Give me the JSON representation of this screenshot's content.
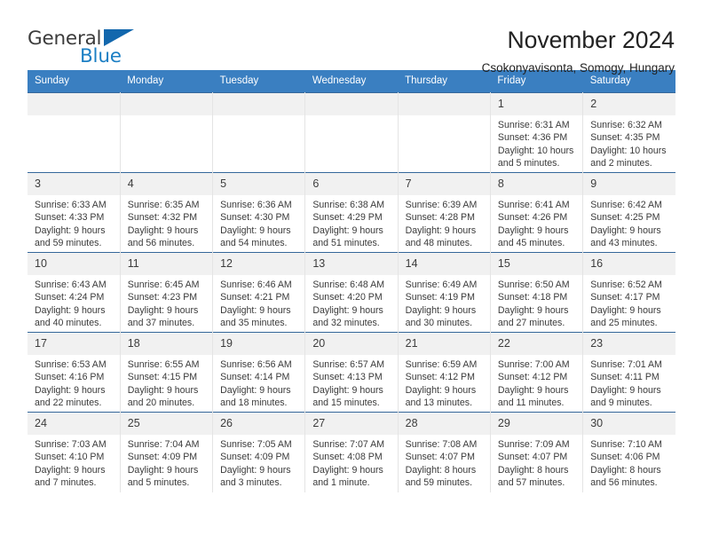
{
  "brand": {
    "name_top": "General",
    "name_bottom": "Blue",
    "triangle_color": "#1267ad",
    "blue_color": "#1c7fc4",
    "gray_color": "#3c3c3c"
  },
  "header": {
    "title": "November 2024",
    "subtitle": "Csokonyavisonta, Somogy, Hungary"
  },
  "theme": {
    "header_row_bg": "#3a7fc1",
    "header_row_text": "#ffffff",
    "daynum_bg": "#f1f1f1",
    "row_border": "#35679a",
    "cell_divider": "#e4e4e4"
  },
  "weekdays": [
    "Sunday",
    "Monday",
    "Tuesday",
    "Wednesday",
    "Thursday",
    "Friday",
    "Saturday"
  ],
  "labels": {
    "sunrise_prefix": "Sunrise:",
    "sunset_prefix": "Sunset:",
    "daylight_prefix": "Daylight:"
  },
  "weeks": [
    [
      {
        "day": "",
        "blank": true
      },
      {
        "day": "",
        "blank": true
      },
      {
        "day": "",
        "blank": true
      },
      {
        "day": "",
        "blank": true
      },
      {
        "day": "",
        "blank": true
      },
      {
        "day": "1",
        "sunrise": "Sunrise: 6:31 AM",
        "sunset": "Sunset: 4:36 PM",
        "daylight_1": "Daylight: 10 hours",
        "daylight_2": "and 5 minutes."
      },
      {
        "day": "2",
        "sunrise": "Sunrise: 6:32 AM",
        "sunset": "Sunset: 4:35 PM",
        "daylight_1": "Daylight: 10 hours",
        "daylight_2": "and 2 minutes."
      }
    ],
    [
      {
        "day": "3",
        "sunrise": "Sunrise: 6:33 AM",
        "sunset": "Sunset: 4:33 PM",
        "daylight_1": "Daylight: 9 hours",
        "daylight_2": "and 59 minutes."
      },
      {
        "day": "4",
        "sunrise": "Sunrise: 6:35 AM",
        "sunset": "Sunset: 4:32 PM",
        "daylight_1": "Daylight: 9 hours",
        "daylight_2": "and 56 minutes."
      },
      {
        "day": "5",
        "sunrise": "Sunrise: 6:36 AM",
        "sunset": "Sunset: 4:30 PM",
        "daylight_1": "Daylight: 9 hours",
        "daylight_2": "and 54 minutes."
      },
      {
        "day": "6",
        "sunrise": "Sunrise: 6:38 AM",
        "sunset": "Sunset: 4:29 PM",
        "daylight_1": "Daylight: 9 hours",
        "daylight_2": "and 51 minutes."
      },
      {
        "day": "7",
        "sunrise": "Sunrise: 6:39 AM",
        "sunset": "Sunset: 4:28 PM",
        "daylight_1": "Daylight: 9 hours",
        "daylight_2": "and 48 minutes."
      },
      {
        "day": "8",
        "sunrise": "Sunrise: 6:41 AM",
        "sunset": "Sunset: 4:26 PM",
        "daylight_1": "Daylight: 9 hours",
        "daylight_2": "and 45 minutes."
      },
      {
        "day": "9",
        "sunrise": "Sunrise: 6:42 AM",
        "sunset": "Sunset: 4:25 PM",
        "daylight_1": "Daylight: 9 hours",
        "daylight_2": "and 43 minutes."
      }
    ],
    [
      {
        "day": "10",
        "sunrise": "Sunrise: 6:43 AM",
        "sunset": "Sunset: 4:24 PM",
        "daylight_1": "Daylight: 9 hours",
        "daylight_2": "and 40 minutes."
      },
      {
        "day": "11",
        "sunrise": "Sunrise: 6:45 AM",
        "sunset": "Sunset: 4:23 PM",
        "daylight_1": "Daylight: 9 hours",
        "daylight_2": "and 37 minutes."
      },
      {
        "day": "12",
        "sunrise": "Sunrise: 6:46 AM",
        "sunset": "Sunset: 4:21 PM",
        "daylight_1": "Daylight: 9 hours",
        "daylight_2": "and 35 minutes."
      },
      {
        "day": "13",
        "sunrise": "Sunrise: 6:48 AM",
        "sunset": "Sunset: 4:20 PM",
        "daylight_1": "Daylight: 9 hours",
        "daylight_2": "and 32 minutes."
      },
      {
        "day": "14",
        "sunrise": "Sunrise: 6:49 AM",
        "sunset": "Sunset: 4:19 PM",
        "daylight_1": "Daylight: 9 hours",
        "daylight_2": "and 30 minutes."
      },
      {
        "day": "15",
        "sunrise": "Sunrise: 6:50 AM",
        "sunset": "Sunset: 4:18 PM",
        "daylight_1": "Daylight: 9 hours",
        "daylight_2": "and 27 minutes."
      },
      {
        "day": "16",
        "sunrise": "Sunrise: 6:52 AM",
        "sunset": "Sunset: 4:17 PM",
        "daylight_1": "Daylight: 9 hours",
        "daylight_2": "and 25 minutes."
      }
    ],
    [
      {
        "day": "17",
        "sunrise": "Sunrise: 6:53 AM",
        "sunset": "Sunset: 4:16 PM",
        "daylight_1": "Daylight: 9 hours",
        "daylight_2": "and 22 minutes."
      },
      {
        "day": "18",
        "sunrise": "Sunrise: 6:55 AM",
        "sunset": "Sunset: 4:15 PM",
        "daylight_1": "Daylight: 9 hours",
        "daylight_2": "and 20 minutes."
      },
      {
        "day": "19",
        "sunrise": "Sunrise: 6:56 AM",
        "sunset": "Sunset: 4:14 PM",
        "daylight_1": "Daylight: 9 hours",
        "daylight_2": "and 18 minutes."
      },
      {
        "day": "20",
        "sunrise": "Sunrise: 6:57 AM",
        "sunset": "Sunset: 4:13 PM",
        "daylight_1": "Daylight: 9 hours",
        "daylight_2": "and 15 minutes."
      },
      {
        "day": "21",
        "sunrise": "Sunrise: 6:59 AM",
        "sunset": "Sunset: 4:12 PM",
        "daylight_1": "Daylight: 9 hours",
        "daylight_2": "and 13 minutes."
      },
      {
        "day": "22",
        "sunrise": "Sunrise: 7:00 AM",
        "sunset": "Sunset: 4:12 PM",
        "daylight_1": "Daylight: 9 hours",
        "daylight_2": "and 11 minutes."
      },
      {
        "day": "23",
        "sunrise": "Sunrise: 7:01 AM",
        "sunset": "Sunset: 4:11 PM",
        "daylight_1": "Daylight: 9 hours",
        "daylight_2": "and 9 minutes."
      }
    ],
    [
      {
        "day": "24",
        "sunrise": "Sunrise: 7:03 AM",
        "sunset": "Sunset: 4:10 PM",
        "daylight_1": "Daylight: 9 hours",
        "daylight_2": "and 7 minutes."
      },
      {
        "day": "25",
        "sunrise": "Sunrise: 7:04 AM",
        "sunset": "Sunset: 4:09 PM",
        "daylight_1": "Daylight: 9 hours",
        "daylight_2": "and 5 minutes."
      },
      {
        "day": "26",
        "sunrise": "Sunrise: 7:05 AM",
        "sunset": "Sunset: 4:09 PM",
        "daylight_1": "Daylight: 9 hours",
        "daylight_2": "and 3 minutes."
      },
      {
        "day": "27",
        "sunrise": "Sunrise: 7:07 AM",
        "sunset": "Sunset: 4:08 PM",
        "daylight_1": "Daylight: 9 hours",
        "daylight_2": "and 1 minute."
      },
      {
        "day": "28",
        "sunrise": "Sunrise: 7:08 AM",
        "sunset": "Sunset: 4:07 PM",
        "daylight_1": "Daylight: 8 hours",
        "daylight_2": "and 59 minutes."
      },
      {
        "day": "29",
        "sunrise": "Sunrise: 7:09 AM",
        "sunset": "Sunset: 4:07 PM",
        "daylight_1": "Daylight: 8 hours",
        "daylight_2": "and 57 minutes."
      },
      {
        "day": "30",
        "sunrise": "Sunrise: 7:10 AM",
        "sunset": "Sunset: 4:06 PM",
        "daylight_1": "Daylight: 8 hours",
        "daylight_2": "and 56 minutes."
      }
    ]
  ]
}
